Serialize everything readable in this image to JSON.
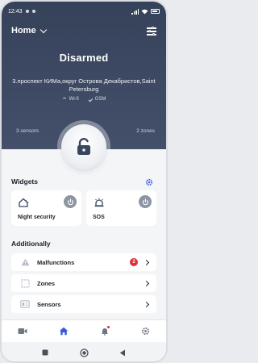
{
  "status_bar": {
    "time": "12:43"
  },
  "header": {
    "title": "Home",
    "state": "Disarmed",
    "address": "3.проспект КИМа,округ Острова Декабристов,Saint Petersburg",
    "wifi_label": "Wi-fi",
    "gsm_label": "GSM",
    "sensors_count": "3 sensors",
    "zones_count": "2 zones"
  },
  "widgets": {
    "title": "Widgets",
    "items": [
      {
        "label": "Night security",
        "icon": "night-security-icon"
      },
      {
        "label": "SOS",
        "icon": "sos-alarm-icon"
      }
    ]
  },
  "additionally": {
    "title": "Additionally",
    "items": [
      {
        "label": "Malfunctions",
        "icon": "warning-icon",
        "badge": "2"
      },
      {
        "label": "Zones",
        "icon": "zones-icon"
      },
      {
        "label": "Sensors",
        "icon": "sensors-icon"
      }
    ]
  },
  "tabbar": {
    "items": [
      {
        "name": "camera-icon"
      },
      {
        "name": "home-icon",
        "active": true
      },
      {
        "name": "bell-icon",
        "notification": true
      },
      {
        "name": "settings-icon"
      }
    ]
  },
  "colors": {
    "accent": "#3a5bd9",
    "header_bg": "#3a465e",
    "badge": "#e02d3c",
    "power": "#8d95a3"
  }
}
